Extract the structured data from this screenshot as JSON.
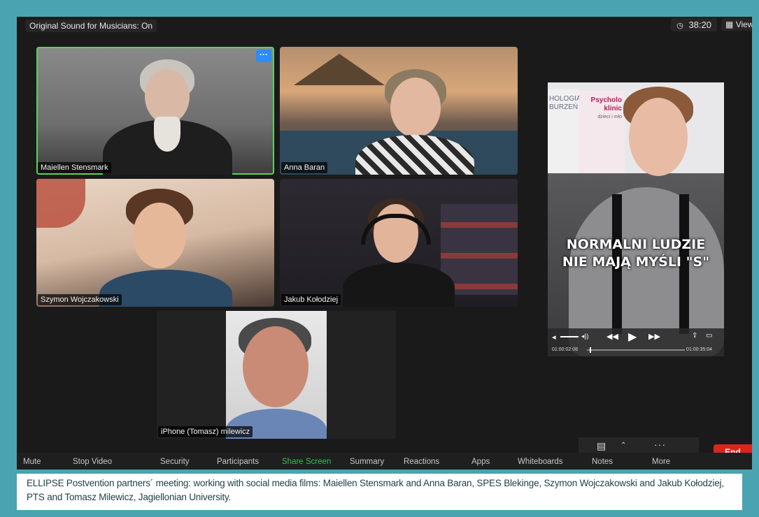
{
  "topbar": {
    "sound_label": "Original Sound for Musicians: On",
    "timer": "38:20",
    "view_label": "View"
  },
  "participants": [
    {
      "name": "Maiellen Stensmark",
      "active": true
    },
    {
      "name": "Anna Baran"
    },
    {
      "name": "Szymon Wojczakowski"
    },
    {
      "name": "Jakub Kołodziej"
    },
    {
      "name": "iPhone (Tomasz) milewicz"
    }
  ],
  "more_label": "···",
  "shared_video": {
    "overlay_line1": "NORMALNI LUDZIE",
    "overlay_line2": "NIE MAJĄ MYŚLI \"S\"",
    "book_line1": "HOLOGIA",
    "book_line2": "BURZEŃ",
    "book2_line1": "Psycholo",
    "book2_line2": "klinic",
    "book2_line3": "dzieci i mło",
    "current_time": "01:00:02:08",
    "total_time": "01:00:35:04"
  },
  "toolbar": {
    "mute": "Mute",
    "stop_video": "Stop Video",
    "security": "Security",
    "participants": "Participants",
    "share_screen": "Share Screen",
    "summary": "Summary",
    "reactions": "Reactions",
    "apps": "Apps",
    "whiteboards": "Whiteboards",
    "notes": "Notes",
    "more": "More",
    "end": "End"
  },
  "caption": "ELLIPSE Postvention partners´ meeting: working with social media films:  Maiellen Stensmark and Anna Baran, SPES Blekinge, Szymon Wojczakowski and Jakub Kołodziej, PTS and Tomasz Milewicz, Jagiellonian University.",
  "colors": {
    "accent_green": "#2fc24f",
    "end_red": "#d9261c",
    "border_teal": "#4aa3b0"
  }
}
